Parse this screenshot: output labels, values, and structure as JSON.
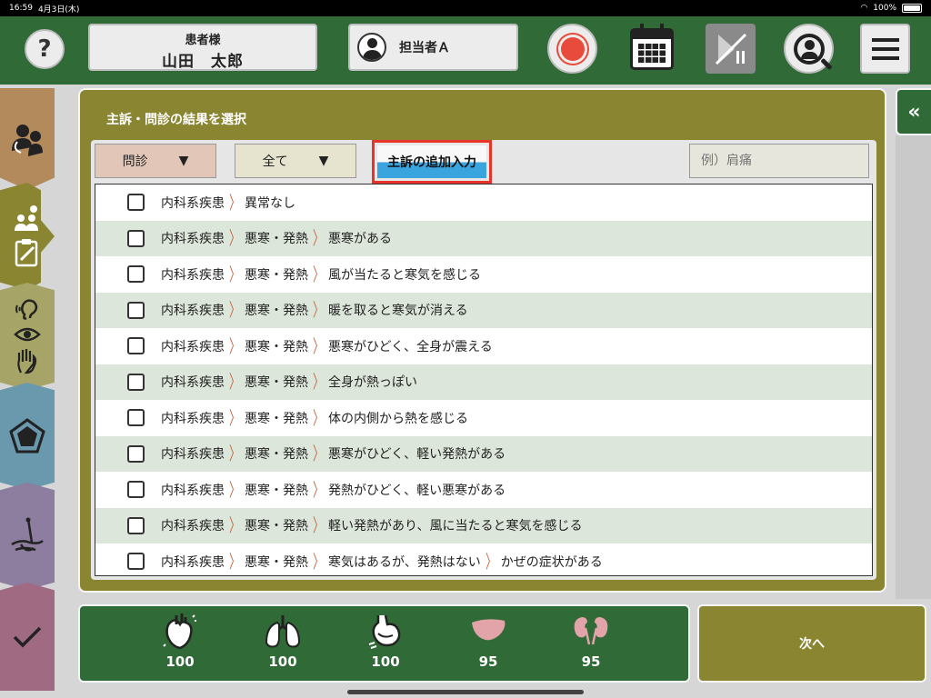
{
  "status_bar": {
    "time": "16:59",
    "date": "4月3日(木)",
    "battery": "100%"
  },
  "header": {
    "help_label": "?",
    "patient_label": "患者様",
    "patient_name": "山田　太郎",
    "staff_name": "担当者Ａ"
  },
  "panel": {
    "title": "主訴・問診の結果を選択",
    "filter1": "問診",
    "filter2": "全て",
    "dropdown_arrow": "▼",
    "add_button": "主訴の追加入力",
    "search_placeholder": "例）肩痛"
  },
  "rows": [
    [
      "内科系疾患",
      "異常なし"
    ],
    [
      "内科系疾患",
      "悪寒・発熱",
      "悪寒がある"
    ],
    [
      "内科系疾患",
      "悪寒・発熱",
      "風が当たると寒気を感じる"
    ],
    [
      "内科系疾患",
      "悪寒・発熱",
      "暖を取ると寒気が消える"
    ],
    [
      "内科系疾患",
      "悪寒・発熱",
      "悪寒がひどく、全身が震える"
    ],
    [
      "内科系疾患",
      "悪寒・発熱",
      "全身が熱っぽい"
    ],
    [
      "内科系疾患",
      "悪寒・発熱",
      "体の内側から熱を感じる"
    ],
    [
      "内科系疾患",
      "悪寒・発熱",
      "悪寒がひどく、軽い発熱がある"
    ],
    [
      "内科系疾患",
      "悪寒・発熱",
      "発熱がひどく、軽い悪寒がある"
    ],
    [
      "内科系疾患",
      "悪寒・発熱",
      "軽い発熱があり、風に当たると寒気を感じる"
    ],
    [
      "内科系疾患",
      "悪寒・発熱",
      "寒気はあるが、発熱はない",
      "かぜの症状がある"
    ]
  ],
  "organs": [
    {
      "name": "heart-icon",
      "value": "100"
    },
    {
      "name": "lungs-icon",
      "value": "100"
    },
    {
      "name": "stomach-icon",
      "value": "100"
    },
    {
      "name": "liver-icon",
      "value": "95"
    },
    {
      "name": "kidney-icon",
      "value": "95"
    }
  ],
  "next_button": "次へ",
  "collapse_label": "«",
  "colors": {
    "header_green": "#2f6a37",
    "panel_olive": "#8a8530",
    "highlight_red": "#e8332a",
    "button_blue": "#3aa4df"
  }
}
